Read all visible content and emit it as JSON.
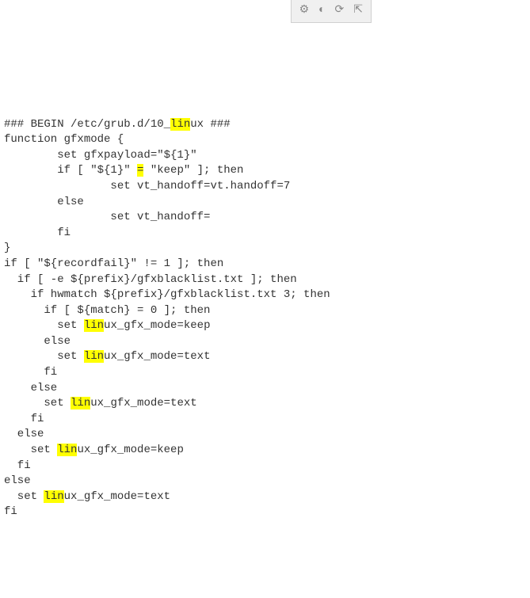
{
  "toolbar": {
    "icon1": "⚙",
    "icon2": "◐",
    "icon3": "⟳",
    "icon4": "⇱"
  },
  "code": {
    "l1_a": "### BEGIN /etc/grub.d/10_",
    "l1_hl": "lin",
    "l1_b": "ux ###",
    "l2": "function gfxmode {",
    "l3": "        set gfxpayload=\"${1}\"",
    "l4_a": "        if [ \"${1}\" ",
    "l4_eq": "=",
    "l4_b": " \"keep\" ]; then",
    "l5": "                set vt_handoff=vt.handoff=7",
    "l6": "        else",
    "l7": "                set vt_handoff=",
    "l8": "        fi",
    "l9": "}",
    "l10": "if [ \"${recordfail}\" != 1 ]; then",
    "l11": "  if [ -e ${prefix}/gfxblacklist.txt ]; then",
    "l12": "    if hwmatch ${prefix}/gfxblacklist.txt 3; then",
    "l13": "      if [ ${match} = 0 ]; then",
    "l14_a": "        set ",
    "l14_hl": "lin",
    "l14_b": "ux_gfx_mode=keep",
    "l15": "      else",
    "l16_a": "        set ",
    "l16_hl": "lin",
    "l16_b": "ux_gfx_mode=text",
    "l17": "      fi",
    "l18": "    else",
    "l19_a": "      set ",
    "l19_hl": "lin",
    "l19_b": "ux_gfx_mode=text",
    "l20": "    fi",
    "l21": "  else",
    "l22_a": "    set ",
    "l22_hl": "lin",
    "l22_b": "ux_gfx_mode=keep",
    "l23": "  fi",
    "l24": "else",
    "l25_a": "  set ",
    "l25_hl": "lin",
    "l25_b": "ux_gfx_mode=text",
    "l26": "fi"
  }
}
